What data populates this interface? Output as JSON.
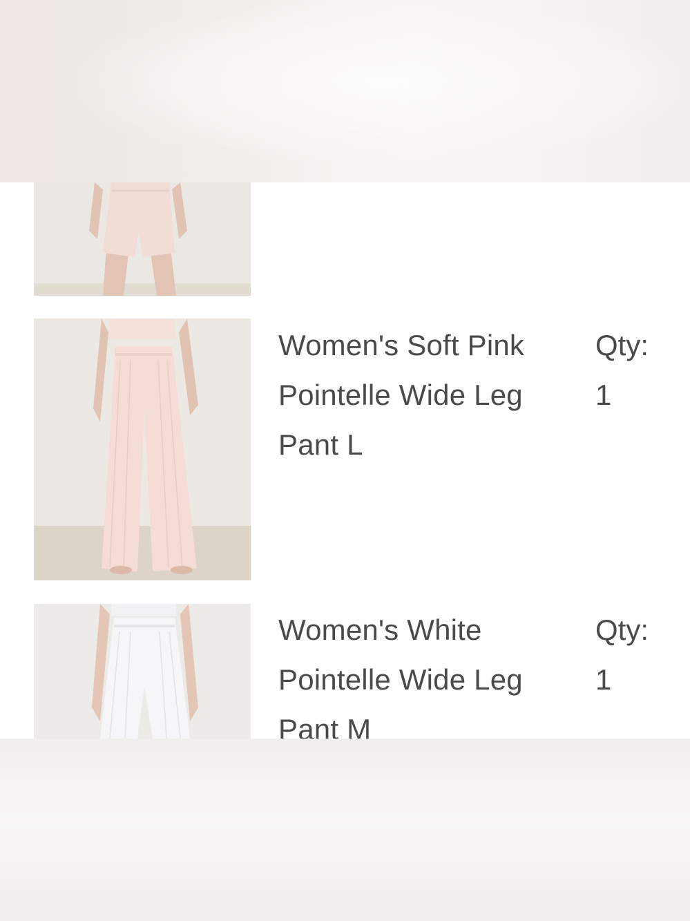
{
  "items": [
    {
      "image": "pink-pointelle-shorts-photo"
    },
    {
      "title": "Women's Soft Pink Pointelle Wide Leg Pant L",
      "qty_label": "Qty:",
      "qty_value": "1",
      "image": "pink-pointelle-wide-leg-pant-photo"
    },
    {
      "title": "Women's White Pointelle Wide Leg Pant M",
      "qty_label": "Qty:",
      "qty_value": "1",
      "image": "white-pointelle-wide-leg-pant-photo"
    }
  ],
  "colors": {
    "text": "#4a4a4a",
    "background": "#ffffff"
  }
}
